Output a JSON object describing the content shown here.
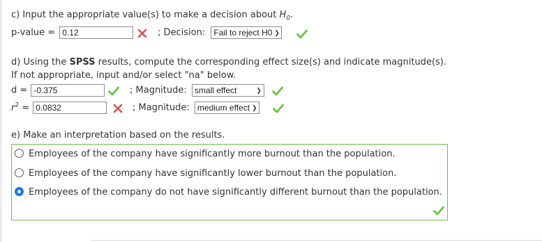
{
  "section_c": {
    "title": "c) Input the appropriate value(s) to make a decision about",
    "h0_symbol": "H",
    "h0_sub": "0",
    "h0_trail": ".",
    "pvalue_label": "p-value =",
    "pvalue_value": "0.12",
    "pvalue_status": "incorrect",
    "decision_label": "; Decision:",
    "decision_selected": "Fail to reject H0",
    "decision_status": "correct"
  },
  "section_d": {
    "title_pre": "d) Using the",
    "title_bold": "SPSS",
    "title_post": "results, compute the corresponding effect size(s) and indicate magnitude(s).",
    "subtitle": "If not appropriate, input and/or select \"na\" below.",
    "d_label": "d =",
    "d_value": "-0.375",
    "d_status": "correct",
    "d_magnitude_label": "; Magnitude:",
    "d_magnitude_selected": "small effect",
    "d_magnitude_status": "correct",
    "r2_label_base": "r",
    "r2_label_sup": "2",
    "r2_label_eq": "=",
    "r2_value": "0.0832",
    "r2_status": "incorrect",
    "r2_magnitude_label": "; Magnitude:",
    "r2_magnitude_selected": "medium effect",
    "r2_magnitude_status": "correct"
  },
  "section_e": {
    "title": "e) Make an interpretation based on the results.",
    "options": [
      {
        "label": "Employees of the company have significantly more burnout than the population.",
        "selected": false
      },
      {
        "label": "Employees of the company have significantly lower burnout than the population.",
        "selected": false
      },
      {
        "label": "Employees of the company do not have significantly different burnout than the population.",
        "selected": true
      }
    ],
    "status": "correct"
  },
  "colors": {
    "correct": "#6abf47",
    "incorrect": "#d9534f",
    "radio_selected": "#1a73e8",
    "text": "#333333"
  },
  "icons": {
    "correct": "check-icon",
    "incorrect": "x-icon"
  }
}
